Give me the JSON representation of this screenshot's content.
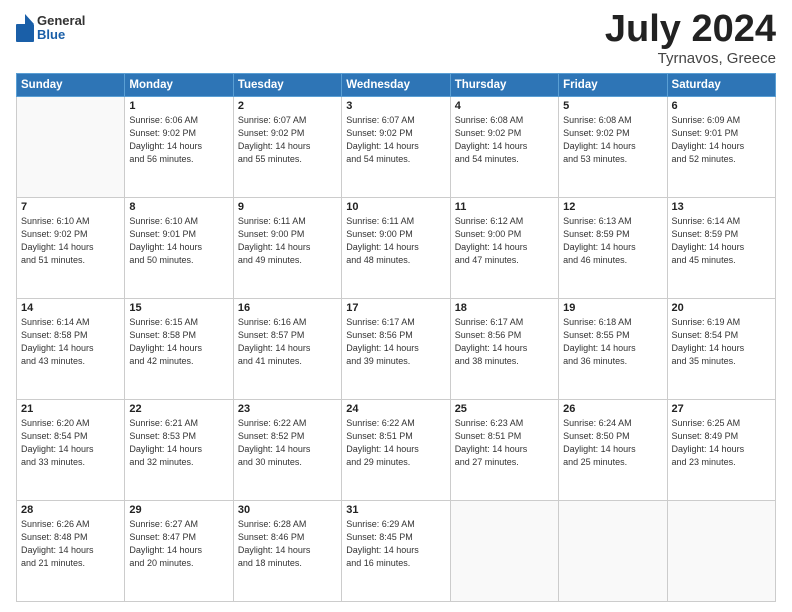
{
  "header": {
    "logo": {
      "general": "General",
      "blue": "Blue"
    },
    "title": "July 2024",
    "location": "Tyrnavos, Greece"
  },
  "calendar": {
    "days_of_week": [
      "Sunday",
      "Monday",
      "Tuesday",
      "Wednesday",
      "Thursday",
      "Friday",
      "Saturday"
    ],
    "weeks": [
      [
        {
          "day": "",
          "info": ""
        },
        {
          "day": "1",
          "info": "Sunrise: 6:06 AM\nSunset: 9:02 PM\nDaylight: 14 hours\nand 56 minutes."
        },
        {
          "day": "2",
          "info": "Sunrise: 6:07 AM\nSunset: 9:02 PM\nDaylight: 14 hours\nand 55 minutes."
        },
        {
          "day": "3",
          "info": "Sunrise: 6:07 AM\nSunset: 9:02 PM\nDaylight: 14 hours\nand 54 minutes."
        },
        {
          "day": "4",
          "info": "Sunrise: 6:08 AM\nSunset: 9:02 PM\nDaylight: 14 hours\nand 54 minutes."
        },
        {
          "day": "5",
          "info": "Sunrise: 6:08 AM\nSunset: 9:02 PM\nDaylight: 14 hours\nand 53 minutes."
        },
        {
          "day": "6",
          "info": "Sunrise: 6:09 AM\nSunset: 9:01 PM\nDaylight: 14 hours\nand 52 minutes."
        }
      ],
      [
        {
          "day": "7",
          "info": "Sunrise: 6:10 AM\nSunset: 9:02 PM\nDaylight: 14 hours\nand 51 minutes."
        },
        {
          "day": "8",
          "info": "Sunrise: 6:10 AM\nSunset: 9:01 PM\nDaylight: 14 hours\nand 50 minutes."
        },
        {
          "day": "9",
          "info": "Sunrise: 6:11 AM\nSunset: 9:00 PM\nDaylight: 14 hours\nand 49 minutes."
        },
        {
          "day": "10",
          "info": "Sunrise: 6:11 AM\nSunset: 9:00 PM\nDaylight: 14 hours\nand 48 minutes."
        },
        {
          "day": "11",
          "info": "Sunrise: 6:12 AM\nSunset: 9:00 PM\nDaylight: 14 hours\nand 47 minutes."
        },
        {
          "day": "12",
          "info": "Sunrise: 6:13 AM\nSunset: 8:59 PM\nDaylight: 14 hours\nand 46 minutes."
        },
        {
          "day": "13",
          "info": "Sunrise: 6:14 AM\nSunset: 8:59 PM\nDaylight: 14 hours\nand 45 minutes."
        }
      ],
      [
        {
          "day": "14",
          "info": "Sunrise: 6:14 AM\nSunset: 8:58 PM\nDaylight: 14 hours\nand 43 minutes."
        },
        {
          "day": "15",
          "info": "Sunrise: 6:15 AM\nSunset: 8:58 PM\nDaylight: 14 hours\nand 42 minutes."
        },
        {
          "day": "16",
          "info": "Sunrise: 6:16 AM\nSunset: 8:57 PM\nDaylight: 14 hours\nand 41 minutes."
        },
        {
          "day": "17",
          "info": "Sunrise: 6:17 AM\nSunset: 8:56 PM\nDaylight: 14 hours\nand 39 minutes."
        },
        {
          "day": "18",
          "info": "Sunrise: 6:17 AM\nSunset: 8:56 PM\nDaylight: 14 hours\nand 38 minutes."
        },
        {
          "day": "19",
          "info": "Sunrise: 6:18 AM\nSunset: 8:55 PM\nDaylight: 14 hours\nand 36 minutes."
        },
        {
          "day": "20",
          "info": "Sunrise: 6:19 AM\nSunset: 8:54 PM\nDaylight: 14 hours\nand 35 minutes."
        }
      ],
      [
        {
          "day": "21",
          "info": "Sunrise: 6:20 AM\nSunset: 8:54 PM\nDaylight: 14 hours\nand 33 minutes."
        },
        {
          "day": "22",
          "info": "Sunrise: 6:21 AM\nSunset: 8:53 PM\nDaylight: 14 hours\nand 32 minutes."
        },
        {
          "day": "23",
          "info": "Sunrise: 6:22 AM\nSunset: 8:52 PM\nDaylight: 14 hours\nand 30 minutes."
        },
        {
          "day": "24",
          "info": "Sunrise: 6:22 AM\nSunset: 8:51 PM\nDaylight: 14 hours\nand 29 minutes."
        },
        {
          "day": "25",
          "info": "Sunrise: 6:23 AM\nSunset: 8:51 PM\nDaylight: 14 hours\nand 27 minutes."
        },
        {
          "day": "26",
          "info": "Sunrise: 6:24 AM\nSunset: 8:50 PM\nDaylight: 14 hours\nand 25 minutes."
        },
        {
          "day": "27",
          "info": "Sunrise: 6:25 AM\nSunset: 8:49 PM\nDaylight: 14 hours\nand 23 minutes."
        }
      ],
      [
        {
          "day": "28",
          "info": "Sunrise: 6:26 AM\nSunset: 8:48 PM\nDaylight: 14 hours\nand 21 minutes."
        },
        {
          "day": "29",
          "info": "Sunrise: 6:27 AM\nSunset: 8:47 PM\nDaylight: 14 hours\nand 20 minutes."
        },
        {
          "day": "30",
          "info": "Sunrise: 6:28 AM\nSunset: 8:46 PM\nDaylight: 14 hours\nand 18 minutes."
        },
        {
          "day": "31",
          "info": "Sunrise: 6:29 AM\nSunset: 8:45 PM\nDaylight: 14 hours\nand 16 minutes."
        },
        {
          "day": "",
          "info": ""
        },
        {
          "day": "",
          "info": ""
        },
        {
          "day": "",
          "info": ""
        }
      ]
    ]
  }
}
